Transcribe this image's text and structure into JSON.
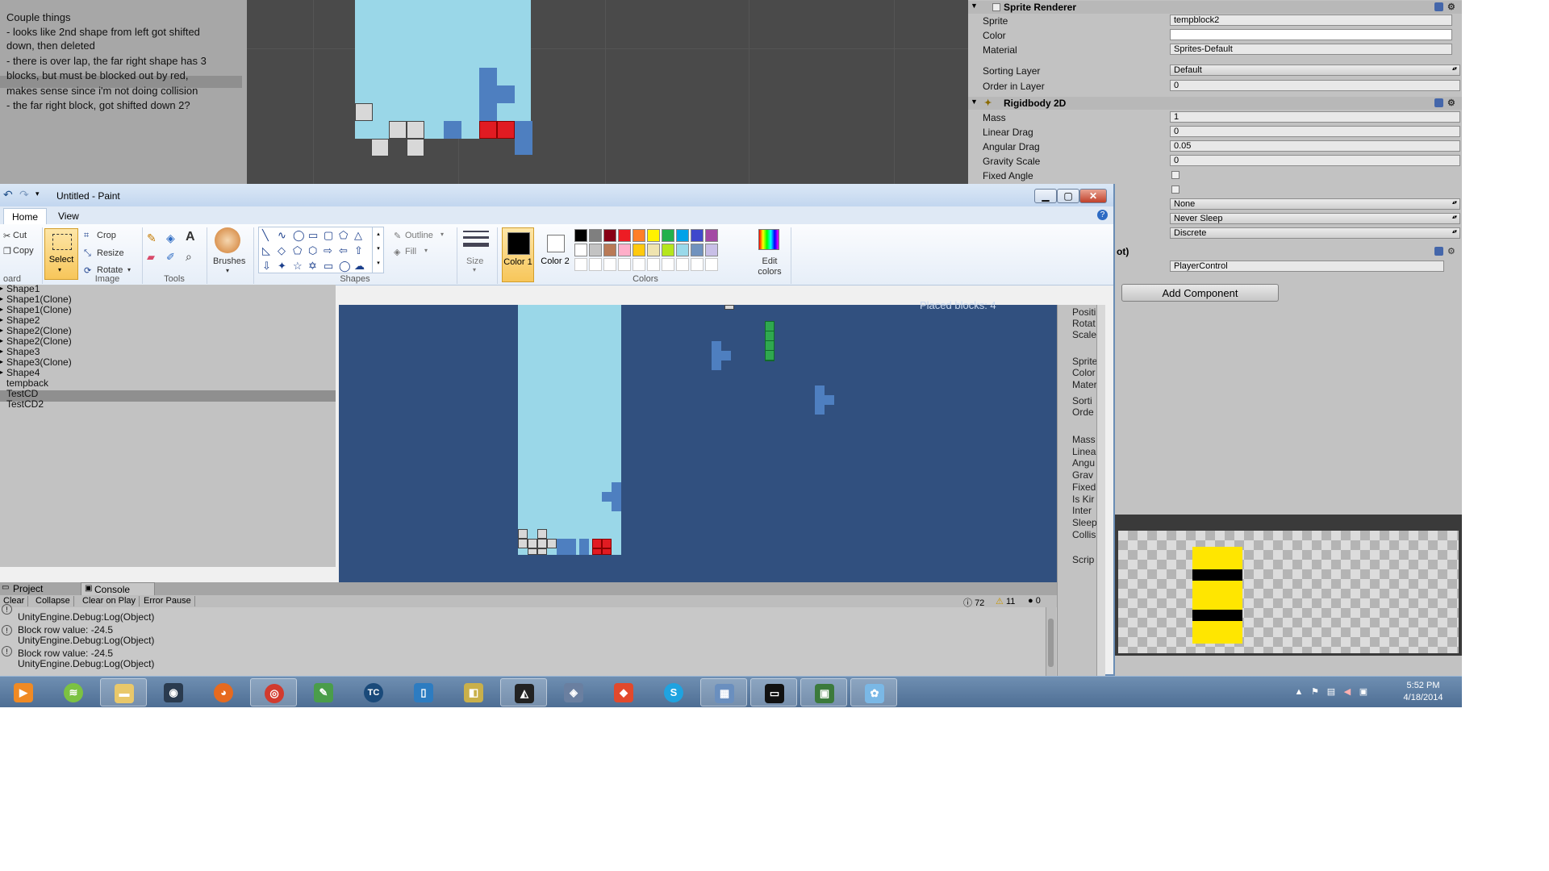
{
  "notes": {
    "lines": [
      "Couple things",
      "- looks like 2nd shape from left got shifted",
      "down, then deleted",
      "- there is over lap, the far right shape has 3",
      "blocks, but must be blocked out by red,",
      "makes sense since i'm not doing collision",
      "- the far right block, got shifted down 2?"
    ]
  },
  "inspector": {
    "sprite_renderer": {
      "title": "Sprite Renderer",
      "sprite_label": "Sprite",
      "sprite_value": "tempblock2",
      "color_label": "Color",
      "material_label": "Material",
      "material_value": "Sprites-Default",
      "sorting_layer_label": "Sorting Layer",
      "sorting_layer_value": "Default",
      "order_label": "Order in Layer",
      "order_value": "0"
    },
    "rigidbody": {
      "title": "Rigidbody 2D",
      "mass_label": "Mass",
      "mass_value": "1",
      "linear_drag_label": "Linear Drag",
      "linear_drag_value": "0",
      "angular_drag_label": "Angular Drag",
      "angular_drag_value": "0.05",
      "gravity_label": "Gravity Scale",
      "gravity_value": "0",
      "fixed_angle_label": "Fixed Angle",
      "interpolate_value": "None",
      "sleeping_value": "Never Sleep",
      "collision_value": "Discrete"
    },
    "script": {
      "title_fragment": "ot)",
      "script_value": "PlayerControl"
    },
    "add_component": "Add Component"
  },
  "paint": {
    "title": "Untitled - Paint",
    "tabs": [
      "Home",
      "View"
    ],
    "clipboard": {
      "cut": "Cut",
      "copy": "Copy",
      "group": "oard"
    },
    "image": {
      "select": "Select",
      "crop": "Crop",
      "resize": "Resize",
      "rotate": "Rotate",
      "group": "Image"
    },
    "tools_group": "Tools",
    "brushes": "Brushes",
    "shapes": {
      "outline": "Outline",
      "fill": "Fill",
      "group": "Shapes"
    },
    "size": "Size",
    "color1": "Color 1",
    "color2": "Color 2",
    "colors_group": "Colors",
    "edit_colors": "Edit colors",
    "palette_row1": [
      "#000000",
      "#7f7f7f",
      "#880015",
      "#ed1c24",
      "#ff7f27",
      "#fff200",
      "#22b14c",
      "#00a2e8",
      "#3f48cc",
      "#a349a4"
    ],
    "palette_row2": [
      "#ffffff",
      "#c3c3c3",
      "#b97a57",
      "#ffaec9",
      "#ffc90e",
      "#efe4b0",
      "#b5e61d",
      "#99d9ea",
      "#7092be",
      "#c8bfe7"
    ]
  },
  "hierarchy": {
    "items": [
      "Shape1",
      "Shape1(Clone)",
      "Shape1(Clone)",
      "Shape2",
      "Shape2(Clone)",
      "Shape2(Clone)",
      "Shape3",
      "Shape3(Clone)",
      "Shape4",
      "tempback",
      "TestCD",
      "TestCD2"
    ],
    "selected": "Shape4"
  },
  "game": {
    "overlay_text": "Placed blocks: 4"
  },
  "console": {
    "tabs": [
      "Project",
      "Console"
    ],
    "buttons": [
      "Clear",
      "Collapse",
      "Clear on Play",
      "Error Pause"
    ],
    "counts": {
      "logs": "72",
      "warnings": "11",
      "errors": "0"
    },
    "entries": [
      {
        "line1": "",
        "line2": "UnityEngine.Debug:Log(Object)"
      },
      {
        "line1": "Block row value: -24.5",
        "line2": "UnityEngine.Debug:Log(Object)"
      },
      {
        "line1": "Block row value: -24.5",
        "line2": "UnityEngine.Debug:Log(Object)"
      }
    ]
  },
  "right_inspector": {
    "labels": [
      "Positi",
      "Rotat",
      "Scale",
      "Sprite",
      "Color",
      "Mater",
      "Sorti",
      "Orde",
      "Mass",
      "Linea",
      "Angu",
      "Grav",
      "Fixed",
      "Is Kir",
      "Inter",
      "Sleep",
      "Collis",
      "Scrip"
    ]
  },
  "taskbar": {
    "apps": [
      "vlc-icon",
      "spotify-icon",
      "explorer-icon",
      "steam-icon",
      "firefox-icon",
      "chrome-icon",
      "notepad-icon",
      "teamcity-icon",
      "phone-icon",
      "ide-icon",
      "unity-icon",
      "vs-icon",
      "git-icon",
      "skype-icon",
      "remote-icon",
      "cmd-icon",
      "monitor-icon",
      "paint-icon"
    ],
    "teamcity_text": "TC",
    "time": "5:52 PM",
    "date": "4/18/2014"
  },
  "colors": {
    "game_bg": "#31507f",
    "well": "#9ad7e8",
    "block_blue": "#4e7fc0",
    "block_red": "#e11b22",
    "block_green": "#2fa84f"
  }
}
